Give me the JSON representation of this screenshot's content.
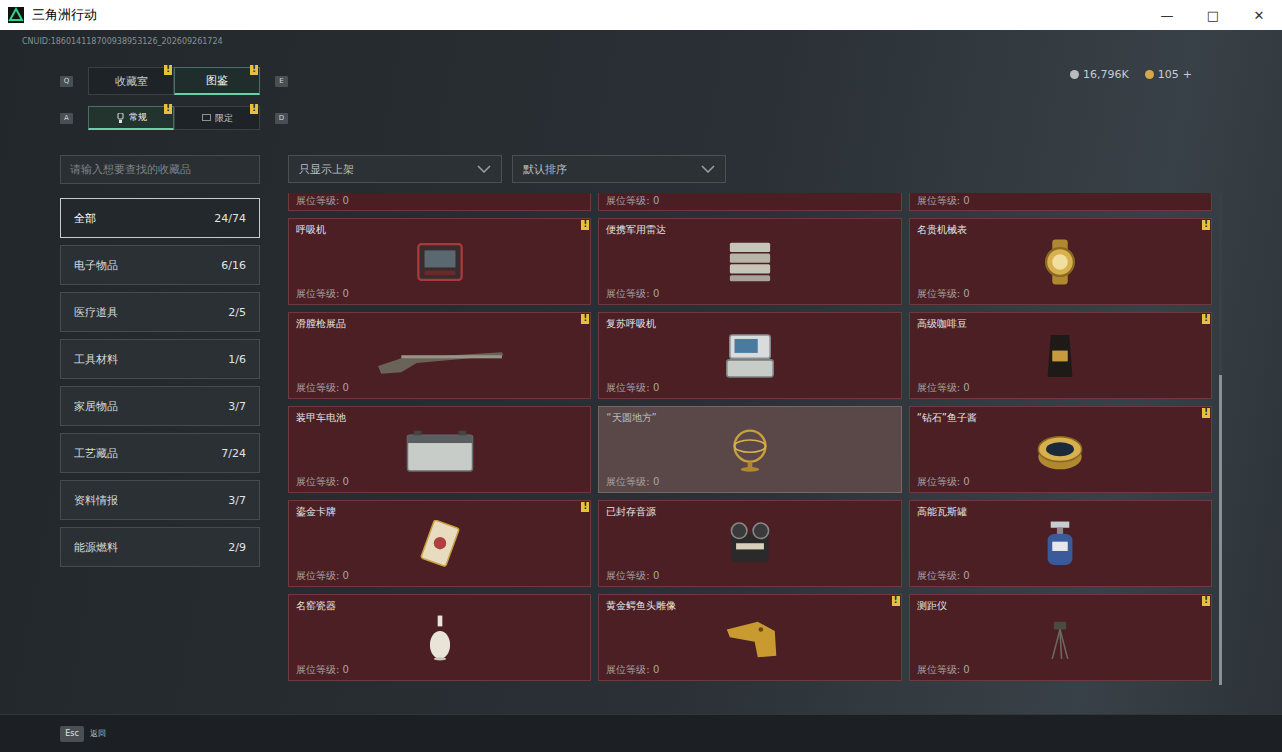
{
  "window": {
    "title": "三角洲行动",
    "controls": [
      "—",
      "□",
      "✕"
    ]
  },
  "uid": "CNUID:186014118700938953126_202609261724",
  "currency": {
    "items": [
      {
        "amount": "16,796K",
        "color": "#b8bcc0"
      },
      {
        "amount": "105",
        "color": "#d4a84a"
      }
    ],
    "add": "+"
  },
  "alert_mark": "!",
  "tabs": {
    "prev_key": "Q",
    "next_key": "E",
    "items": [
      {
        "label": "收藏室",
        "selected": false,
        "alert": true
      },
      {
        "label": "图鉴",
        "selected": true,
        "alert": true
      }
    ]
  },
  "subtabs": {
    "prev_key": "A",
    "next_key": "D",
    "items": [
      {
        "label": "常规",
        "selected": true,
        "alert": true
      },
      {
        "label": "限定",
        "selected": false,
        "alert": true
      }
    ]
  },
  "search": {
    "placeholder": "请输入想要查找的收藏品"
  },
  "filters": [
    {
      "value": "只显示上架"
    },
    {
      "value": "默认排序"
    }
  ],
  "categories": [
    {
      "label": "全部",
      "count": "24/74",
      "selected": true
    },
    {
      "label": "电子物品",
      "count": "6/16",
      "selected": false
    },
    {
      "label": "医疗道具",
      "count": "2/5",
      "selected": false
    },
    {
      "label": "工具材料",
      "count": "1/6",
      "selected": false
    },
    {
      "label": "家居物品",
      "count": "3/7",
      "selected": false
    },
    {
      "label": "工艺藏品",
      "count": "7/24",
      "selected": false
    },
    {
      "label": "资料情报",
      "count": "3/7",
      "selected": false
    },
    {
      "label": "能源燃料",
      "count": "2/9",
      "selected": false
    }
  ],
  "partial_cards": [
    {
      "level": "展位等级: 0"
    },
    {
      "level": "展位等级: 0"
    },
    {
      "level": "展位等级: 0"
    }
  ],
  "cards": [
    {
      "name": "呼吸机",
      "level": "展位等级: 0",
      "alert": true,
      "selected": false
    },
    {
      "name": "便携军用雷达",
      "level": "展位等级: 0",
      "alert": false,
      "selected": false
    },
    {
      "name": "名贵机械表",
      "level": "展位等级: 0",
      "alert": true,
      "selected": false
    },
    {
      "name": "滑膛枪展品",
      "level": "展位等级: 0",
      "alert": true,
      "selected": false
    },
    {
      "name": "复苏呼吸机",
      "level": "展位等级: 0",
      "alert": false,
      "selected": false
    },
    {
      "name": "高级咖啡豆",
      "level": "展位等级: 0",
      "alert": true,
      "selected": false
    },
    {
      "name": "装甲车电池",
      "level": "展位等级: 0",
      "alert": false,
      "selected": false
    },
    {
      "name": "“天圆地方”",
      "level": "展位等级: 0",
      "alert": false,
      "selected": true
    },
    {
      "name": "“钻石”鱼子酱",
      "level": "展位等级: 0",
      "alert": true,
      "selected": false
    },
    {
      "name": "鎏金卡牌",
      "level": "展位等级: 0",
      "alert": true,
      "selected": false
    },
    {
      "name": "已封存音源",
      "level": "展位等级: 0",
      "alert": false,
      "selected": false
    },
    {
      "name": "高能瓦斯罐",
      "level": "展位等级: 0",
      "alert": false,
      "selected": false
    },
    {
      "name": "名窑瓷器",
      "level": "展位等级: 0",
      "alert": false,
      "selected": false
    },
    {
      "name": "黄金鳄鱼头雕像",
      "level": "展位等级: 0",
      "alert": true,
      "selected": false
    },
    {
      "name": "测距仪",
      "level": "展位等级: 0",
      "alert": true,
      "selected": false
    }
  ],
  "scrollbar": {
    "level": 1,
    "thumb_share": 0.63
  },
  "footer": {
    "key": "Esc",
    "label": "返回"
  }
}
